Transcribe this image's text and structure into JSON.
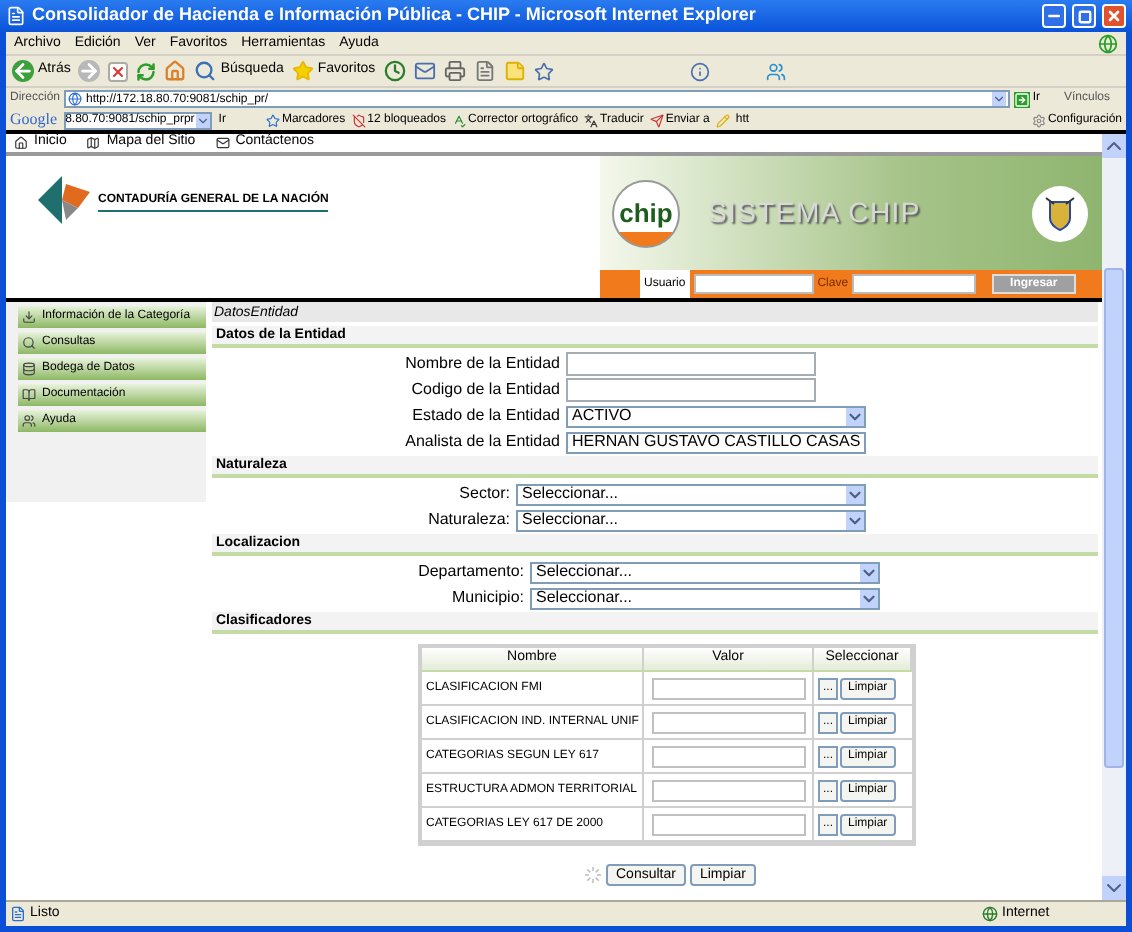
{
  "window": {
    "title": "Consolidador de Hacienda e Información Pública - CHIP - Microsoft Internet Explorer"
  },
  "menu": [
    "Archivo",
    "Edición",
    "Ver",
    "Favoritos",
    "Herramientas",
    "Ayuda"
  ],
  "toolbar": {
    "back": "Atrás",
    "search": "Búsqueda",
    "favorites": "Favoritos"
  },
  "address_bar": {
    "label": "Dirección",
    "value": "http://172.18.80.70:9081/schip_pr/",
    "go": "Ir",
    "links": "Vínculos"
  },
  "google_bar": {
    "logo": "Google",
    "search_value": "8.80.70:9081/schip_prpr",
    "go": "Ir",
    "bookmarks": "Marcadores",
    "blocked": "12 bloqueados",
    "spellcheck": "Corrector ortográfico",
    "translate": "Traducir",
    "send": "Enviar a",
    "more": "htt",
    "settings": "Configuración"
  },
  "site_links": [
    "Inicio",
    "Mapa del Sitio",
    "Contáctenos"
  ],
  "header": {
    "org": "CONTADURÍA GENERAL DE LA NACIÓN",
    "logo_text": "chip",
    "system": "SISTEMA CHIP",
    "user_label": "Usuario",
    "password_label": "Clave",
    "login_button": "Ingresar"
  },
  "sidebar": {
    "items": [
      {
        "label": "Información de la Categoría"
      },
      {
        "label": "Consultas"
      },
      {
        "label": "Bodega de Datos"
      },
      {
        "label": "Documentación"
      },
      {
        "label": "Ayuda"
      }
    ]
  },
  "breadcrumb": "DatosEntidad",
  "sections": [
    {
      "title": "Datos de la Entidad",
      "fields": [
        {
          "kind": "text",
          "label": "Nombre de la Entidad"
        },
        {
          "kind": "text",
          "label": "Codigo de la Entidad"
        },
        {
          "kind": "select",
          "label": "Estado de la Entidad",
          "value": "ACTIVO"
        },
        {
          "kind": "select",
          "label": "Analista de la Entidad",
          "value": "HERNAN GUSTAVO CASTILLO CASAS"
        }
      ]
    },
    {
      "title": "Naturaleza",
      "fields": [
        {
          "kind": "select",
          "label": "Sector:",
          "value": "Seleccionar..."
        },
        {
          "kind": "select",
          "label": "Naturaleza:",
          "value": "Seleccionar..."
        }
      ]
    },
    {
      "title": "Localizacion",
      "fields": [
        {
          "kind": "select",
          "label": "Departamento:",
          "value": "Seleccionar..."
        },
        {
          "kind": "select",
          "label": "Municipio:",
          "value": "Seleccionar..."
        }
      ]
    },
    {
      "title": "Clasificadores"
    }
  ],
  "classifiers": {
    "columns": [
      "Nombre",
      "Valor",
      "Seleccionar"
    ],
    "rows": [
      {
        "name": "CLASIFICACION FMI",
        "pick": "...",
        "clear": "Limpiar"
      },
      {
        "name": "CLASIFICACION IND. INTERNAL UNIF",
        "pick": "...",
        "clear": "Limpiar"
      },
      {
        "name": "CATEGORIAS SEGUN LEY 617",
        "pick": "...",
        "clear": "Limpiar"
      },
      {
        "name": "ESTRUCTURA ADMON TERRITORIAL",
        "pick": "...",
        "clear": "Limpiar"
      },
      {
        "name": "CATEGORIAS LEY 617 DE 2000",
        "pick": "...",
        "clear": "Limpiar"
      }
    ]
  },
  "actions": [
    "Consultar",
    "Limpiar"
  ],
  "status_bar": {
    "text": "Listo",
    "zone": "Internet"
  }
}
